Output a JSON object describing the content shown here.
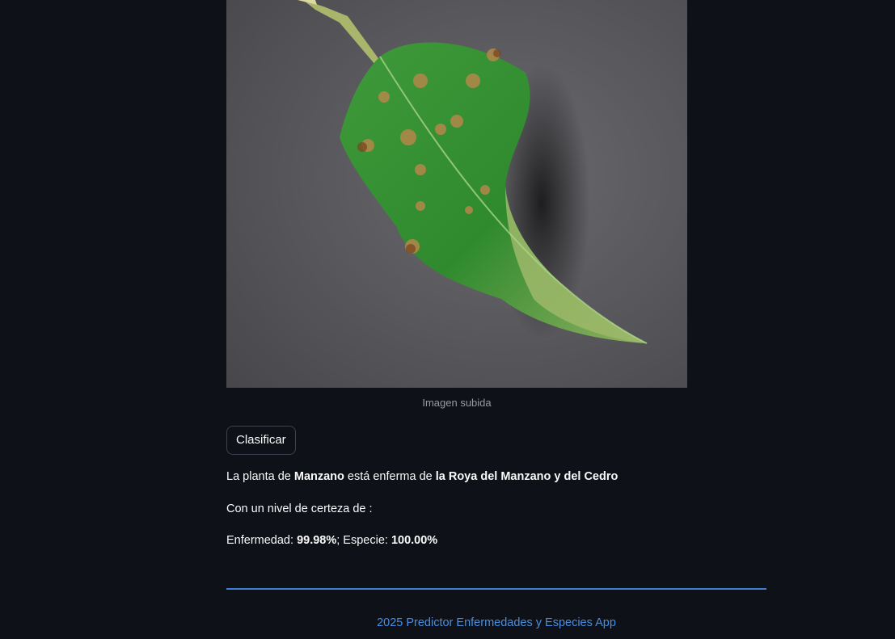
{
  "image": {
    "caption": "Imagen subida"
  },
  "actions": {
    "classify_label": "Clasificar"
  },
  "result": {
    "line1_prefix": "La planta de ",
    "species": "Manzano",
    "line1_middle": " está enferma de ",
    "disease": "la Roya del Manzano y del Cedro",
    "line2": "Con un nivel de certeza de :",
    "disease_label": "Enfermedad: ",
    "disease_confidence": "99.98%",
    "separator": "; Especie: ",
    "species_confidence": "100.00%"
  },
  "footer": {
    "text": "2025 Predictor Enfermedades y Especies App"
  },
  "colors": {
    "background": "#0e1117",
    "accent": "#3f7fd1",
    "footer_text": "#4a8ee0"
  }
}
